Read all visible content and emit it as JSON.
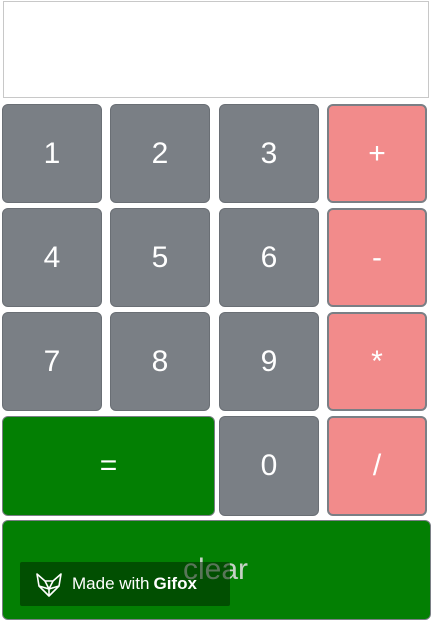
{
  "display": {
    "value": ""
  },
  "keys": {
    "k1": "1",
    "k2": "2",
    "k3": "3",
    "plus": "+",
    "k4": "4",
    "k5": "5",
    "k6": "6",
    "minus": "-",
    "k7": "7",
    "k8": "8",
    "k9": "9",
    "multiply": "*",
    "equals": "=",
    "k0": "0",
    "divide": "/",
    "clear": "clear"
  },
  "watermark": {
    "prefix": "Made with",
    "brand": "Gifox",
    "icon": "fox-logo-icon"
  },
  "colors": {
    "number_key": "#7a7f85",
    "operator_key": "#f28b8b",
    "action_key": "#037f03"
  }
}
